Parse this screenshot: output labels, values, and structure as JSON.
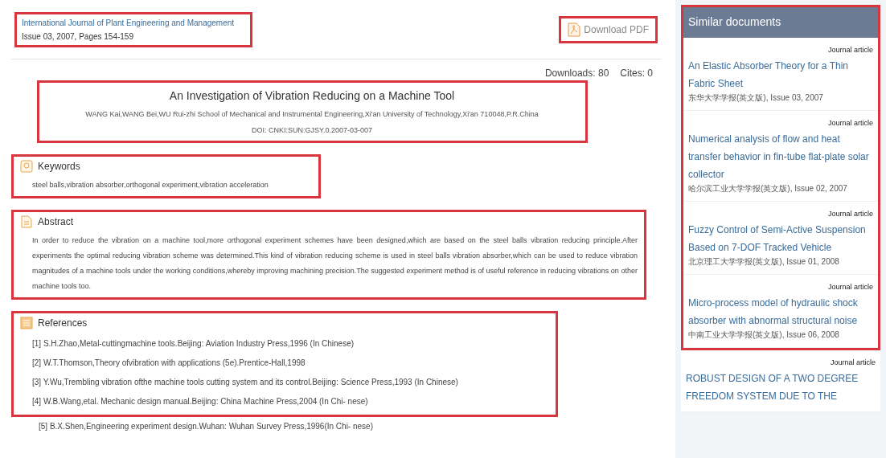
{
  "journal": {
    "name": "International Journal of Plant Engineering and Management",
    "issue": "Issue 03, 2007, Pages 154-159",
    "highlighted": true
  },
  "download": {
    "label": "Download PDF",
    "highlighted": true
  },
  "stats": {
    "downloads": "Downloads: 80",
    "cites": "Cites: 0"
  },
  "article": {
    "title": "An Investigation of Vibration Reducing on a Machine Tool",
    "authors": "WANG Kai,WANG Bei,WU Rui-zhi School of Mechanical and Instrumental Engineering,Xi'an University of Technology,Xi'an 710048,P.R.China",
    "doi": "DOI: CNKI:SUN:GJSY.0.2007-03-007",
    "highlighted": true
  },
  "sections": [
    {
      "kind": "keywords",
      "heading": "Keywords",
      "highlighted": true,
      "text": "steel balls,vibration absorber,orthogonal experiment,vibration acceleration"
    },
    {
      "kind": "abstract",
      "heading": "Abstract",
      "highlighted": true,
      "text": "In order to reduce the vibration on a machine tool,more orthogonal experiment schemes have been designed,which are based on the steel balls vibration reducing principle.After experiments the optimal reducing vibration scheme was determined.This kind of vibration reducing scheme is used in steel balls vibration absorber,which can be used to reduce vibration magnitudes of a machine tools under the working conditions,whereby improving machining precision.The suggested experiment method is of useful reference in reducing vibrations on other machine tools too."
    },
    {
      "kind": "references",
      "heading": "References",
      "highlighted": true,
      "items": [
        {
          "text": "[1] S.H.Zhao,Metal-cuttingmachine tools.Beijing: Aviation Industry Press,1996 (In Chinese)",
          "highlighted": true
        },
        {
          "text": "[2] W.T.Thomson,Theory ofvibration with applications (5e).Prentice-Hall,1998",
          "highlighted": true
        },
        {
          "text": "[3] Y.Wu,Trembling vibration ofthe machine tools cutting system and its control.Beijing: Science Press,1993 (In Chinese)",
          "highlighted": true
        },
        {
          "text": "[4] W.B.Wang,etal. Mechanic design manual.Beijing: China Machine Press,2004 (In Chi- nese)",
          "highlighted": true
        },
        {
          "text": "[5] B.X.Shen,Engineering experiment design.Wuhan: Wuhan Survey Press,1996(In Chi- nese)",
          "highlighted": false
        }
      ]
    }
  ],
  "sidebar": {
    "title": "Similar documents",
    "items": [
      {
        "type": "Journal article",
        "title": "An Elastic Absorber Theory for a Thin Fabric Sheet",
        "source": "东华大学学报(英文版), Issue 03, 2007",
        "highlighted": true
      },
      {
        "type": "Journal article",
        "title": "Numerical analysis of flow and heat transfer behavior in fin-tube flat-plate solar collector",
        "source": "哈尔滨工业大学学报(英文版), Issue 02, 2007",
        "highlighted": true
      },
      {
        "type": "Journal article",
        "title": "Fuzzy Control of Semi-Active Suspension Based on 7-DOF Tracked Vehicle",
        "source": "北京理工大学学报(英文版), Issue 01, 2008",
        "highlighted": true
      },
      {
        "type": "Journal article",
        "title": "Micro-process model of hydraulic shock absorber with abnormal structural noise",
        "source": "中南工业大学学报(英文版), Issue 06, 2008",
        "highlighted": true
      },
      {
        "type": "Journal article",
        "title": "ROBUST DESIGN OF A TWO DEGREE FREEDOM SYSTEM DUE TO THE",
        "highlighted": false
      }
    ]
  }
}
